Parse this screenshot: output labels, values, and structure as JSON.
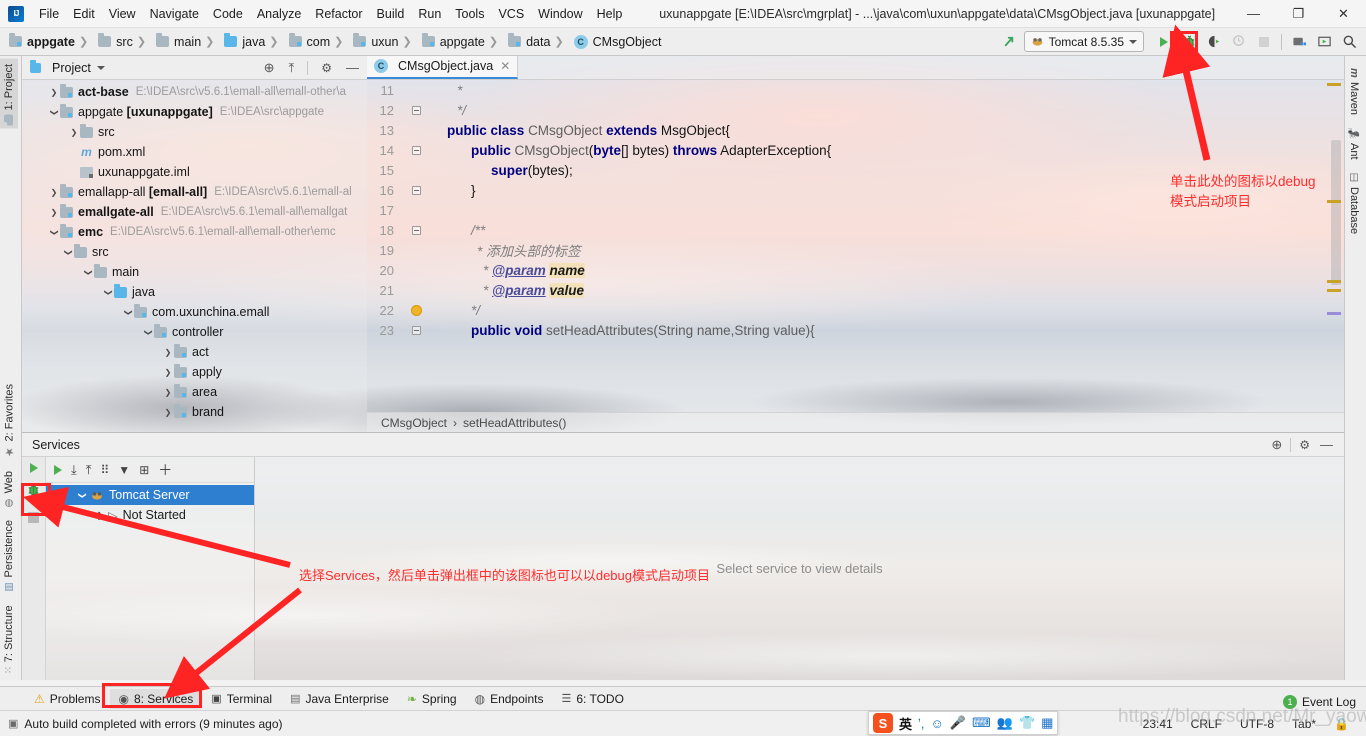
{
  "window": {
    "title": "uxunappgate [E:\\IDEA\\src\\mgrplat] - ...\\java\\com\\uxun\\appgate\\data\\CMsgObject.java [uxunappgate]",
    "minimize": "—",
    "maximize": "❐",
    "close": "✕",
    "logo": "ij-logo"
  },
  "menu": [
    "File",
    "Edit",
    "View",
    "Navigate",
    "Code",
    "Analyze",
    "Refactor",
    "Build",
    "Run",
    "Tools",
    "VCS",
    "Window",
    "Help"
  ],
  "breadcrumbs": [
    {
      "label": "appgate",
      "icon": "module-folder-icon",
      "bold": true
    },
    {
      "label": "src",
      "icon": "folder-icon",
      "bold": false
    },
    {
      "label": "main",
      "icon": "folder-icon",
      "bold": false
    },
    {
      "label": "java",
      "icon": "source-folder-icon",
      "bold": false
    },
    {
      "label": "com",
      "icon": "package-folder-icon",
      "bold": false
    },
    {
      "label": "uxun",
      "icon": "package-folder-icon",
      "bold": false
    },
    {
      "label": "appgate",
      "icon": "package-folder-icon",
      "bold": false
    },
    {
      "label": "data",
      "icon": "package-folder-icon",
      "bold": false
    },
    {
      "label": "CMsgObject",
      "icon": "class-icon",
      "bold": false
    }
  ],
  "toolbar": {
    "update_icon": "update-project-icon",
    "run_config": "Tomcat 8.5.35",
    "run_config_icon": "tomcat-icon",
    "run_button": "run-icon",
    "debug_button": "debug-icon",
    "run_coverage_button": "run-with-coverage-icon",
    "profile_button": "profile-icon",
    "stop_button": "stop-icon",
    "project_structure_button": "project-structure-icon",
    "select_opened_file_button": "select-opened-file-icon",
    "search_button": "search-everywhere-icon"
  },
  "left_strip": [
    {
      "label": "1: Project",
      "icon": "project-icon",
      "selected": true
    },
    {
      "label": "2: Favorites",
      "icon": "star-icon",
      "selected": false
    },
    {
      "label": "Web",
      "icon": "web-icon",
      "selected": false
    },
    {
      "label": "Persistence",
      "icon": "persistence-icon",
      "selected": false
    },
    {
      "label": "7: Structure",
      "icon": "structure-icon",
      "selected": false
    }
  ],
  "right_strip": [
    {
      "label": "Maven",
      "icon": "maven-icon"
    },
    {
      "label": "Ant",
      "icon": "ant-icon"
    },
    {
      "label": "Database",
      "icon": "database-icon"
    }
  ],
  "project_panel": {
    "title": "Project",
    "icons": [
      "locate-icon",
      "collapse-all-icon",
      "gear-icon",
      "hide-icon"
    ],
    "tree": [
      {
        "indent": 0,
        "arrow": "right",
        "icon": "module-folder-icon",
        "label": "act-base",
        "bold": true,
        "path": "E:\\IDEA\\src\\v5.6.1\\emall-all\\emall-other\\a"
      },
      {
        "indent": 0,
        "arrow": "down",
        "icon": "module-folder-icon",
        "label": "appgate [uxunappgate]",
        "bold": false,
        "path": "E:\\IDEA\\src\\appgate"
      },
      {
        "indent": 1,
        "arrow": "right",
        "icon": "folder-icon",
        "label": "src",
        "bold": false,
        "path": ""
      },
      {
        "indent": 2,
        "arrow": "none",
        "icon": "maven-file-icon",
        "label": "pom.xml",
        "bold": false,
        "path": ""
      },
      {
        "indent": 2,
        "arrow": "none",
        "icon": "iml-file-icon",
        "label": "uxunappgate.iml",
        "bold": false,
        "path": ""
      },
      {
        "indent": 0,
        "arrow": "right",
        "icon": "module-folder-icon",
        "label": "emallapp-all [emall-all]",
        "bold": false,
        "path": "E:\\IDEA\\src\\v5.6.1\\emall-al"
      },
      {
        "indent": 0,
        "arrow": "right",
        "icon": "module-folder-icon",
        "label": "emallgate-all",
        "bold": true,
        "path": "E:\\IDEA\\src\\v5.6.1\\emall-all\\emallgat"
      },
      {
        "indent": 0,
        "arrow": "down",
        "icon": "module-folder-icon",
        "label": "emc",
        "bold": true,
        "path": "E:\\IDEA\\src\\v5.6.1\\emall-all\\emall-other\\emc"
      },
      {
        "indent": 1,
        "arrow": "down",
        "icon": "folder-icon",
        "label": "src",
        "bold": false,
        "path": ""
      },
      {
        "indent": 2,
        "arrow": "down",
        "icon": "folder-icon",
        "label": "main",
        "bold": false,
        "path": ""
      },
      {
        "indent": 3,
        "arrow": "down",
        "icon": "source-folder-icon",
        "label": "java",
        "bold": false,
        "path": ""
      },
      {
        "indent": 4,
        "arrow": "down",
        "icon": "package-folder-icon",
        "label": "com.uxunchina.emall",
        "bold": false,
        "path": ""
      },
      {
        "indent": 5,
        "arrow": "down",
        "icon": "package-folder-icon",
        "label": "controller",
        "bold": false,
        "path": ""
      },
      {
        "indent": 6,
        "arrow": "right",
        "icon": "package-folder-icon",
        "label": "act",
        "bold": false,
        "path": ""
      },
      {
        "indent": 6,
        "arrow": "right",
        "icon": "package-folder-icon",
        "label": "apply",
        "bold": false,
        "path": ""
      },
      {
        "indent": 6,
        "arrow": "right",
        "icon": "package-folder-icon",
        "label": "area",
        "bold": false,
        "path": ""
      },
      {
        "indent": 6,
        "arrow": "right",
        "icon": "package-folder-icon",
        "label": "brand",
        "bold": false,
        "path": ""
      }
    ]
  },
  "editor": {
    "tab": {
      "label": "CMsgObject.java",
      "icon": "class-icon",
      "close": "✕"
    },
    "breadcrumb": [
      "CMsgObject",
      "setHeadAttributes()"
    ],
    "breadcrumb_sep": "›",
    "lines": [
      {
        "num": "11",
        "fold": "none",
        "marker": "none"
      },
      {
        "num": "12",
        "fold": "end",
        "marker": "none"
      },
      {
        "num": "13",
        "fold": "none",
        "marker": "none"
      },
      {
        "num": "14",
        "fold": "start",
        "marker": "none"
      },
      {
        "num": "15",
        "fold": "none",
        "marker": "none"
      },
      {
        "num": "16",
        "fold": "end",
        "marker": "none"
      },
      {
        "num": "17",
        "fold": "none",
        "marker": "none"
      },
      {
        "num": "18",
        "fold": "start",
        "marker": "none"
      },
      {
        "num": "19",
        "fold": "none",
        "marker": "none"
      },
      {
        "num": "20",
        "fold": "none",
        "marker": "none"
      },
      {
        "num": "21",
        "fold": "none",
        "marker": "none"
      },
      {
        "num": "22",
        "fold": "end",
        "marker": "bulb"
      },
      {
        "num": "23",
        "fold": "start",
        "marker": "none"
      }
    ],
    "code": {
      "l11": "*",
      "l12": "*/",
      "l13_kw1": "public class",
      "l13_name": "CMsgObject",
      "l13_kw2": "extends",
      "l13_super": "MsgObject{",
      "l14_kw1": "public",
      "l14_name": "CMsgObject",
      "l14_p1": "(",
      "l14_kw2": "byte",
      "l14_p2": "[] bytes)",
      "l14_kw3": "throws",
      "l14_exc": "AdapterException{",
      "l15_kw": "super",
      "l15_rest": "(bytes);",
      "l16": "}",
      "l18": "/**",
      "l19": "* 添加头部的标签",
      "l20_star": "*",
      "l20_tag": "@param",
      "l20_param": "name",
      "l21_star": "*",
      "l21_tag": "@param",
      "l21_param": "value",
      "l22": "*/",
      "l23_kw": "public void",
      "l23_rest": "setHeadAttributes(String name,String value){"
    }
  },
  "services": {
    "title": "Services",
    "head_icons": [
      "locate-icon",
      "gear-icon",
      "hide-icon"
    ],
    "vbar_icons": [
      "run-icon",
      "debug-icon",
      "stop-icon"
    ],
    "toolbar_icons": [
      "run-icon",
      "expand-all-icon",
      "collapse-all-icon",
      "group-icon",
      "filter-icon",
      "add-tab-icon",
      "add-icon"
    ],
    "tree": [
      {
        "indent": 0,
        "arrow": "down",
        "icon": "tomcat-icon",
        "label": "Tomcat Server",
        "selected": true
      },
      {
        "indent": 1,
        "arrow": "right",
        "icon": "not-started-icon",
        "label": "Not Started",
        "selected": false
      }
    ],
    "empty_message": "Select service to view details"
  },
  "bottom_tabs": [
    {
      "label": "Problems",
      "icon": "warning-icon",
      "active": false
    },
    {
      "label": "8: Services",
      "icon": "services-icon",
      "active": true
    },
    {
      "label": "Terminal",
      "icon": "terminal-icon",
      "active": false
    },
    {
      "label": "Java Enterprise",
      "icon": "java-enterprise-icon",
      "active": false
    },
    {
      "label": "Spring",
      "icon": "spring-icon",
      "active": false
    },
    {
      "label": "Endpoints",
      "icon": "endpoints-icon",
      "active": false
    },
    {
      "label": "6: TODO",
      "icon": "todo-icon",
      "active": false
    }
  ],
  "event_log": {
    "label": "Event Log",
    "count": "1"
  },
  "status": {
    "message": "Auto build completed with errors (9 minutes ago)",
    "message_icon": "build-icon",
    "caret": "23:41",
    "line_sep": "CRLF",
    "encoding": "UTF-8",
    "indent": "Tab*"
  },
  "ime": {
    "logo": "S",
    "mode": "英",
    "icons": [
      "comma-icon",
      "emoji-icon",
      "mic-icon",
      "keyboard-icon",
      "user-icon",
      "skin-icon",
      "apps-icon"
    ]
  },
  "watermark": "https://blog.csdn.net/Mr_yaowei",
  "annotations": [
    {
      "id": "anno-top",
      "lines": [
        "单击此处的图标以debug",
        "模式启动项目"
      ]
    },
    {
      "id": "anno-bottom",
      "lines": [
        "选择Services，然后单击弹出框中的该图标也可以以debug模式启动项目"
      ]
    }
  ],
  "colors": {
    "accent": "#2f7fd0",
    "annotation": "#ff2d2d",
    "run_green": "#4caf50",
    "selection": "#2f7fd0"
  }
}
